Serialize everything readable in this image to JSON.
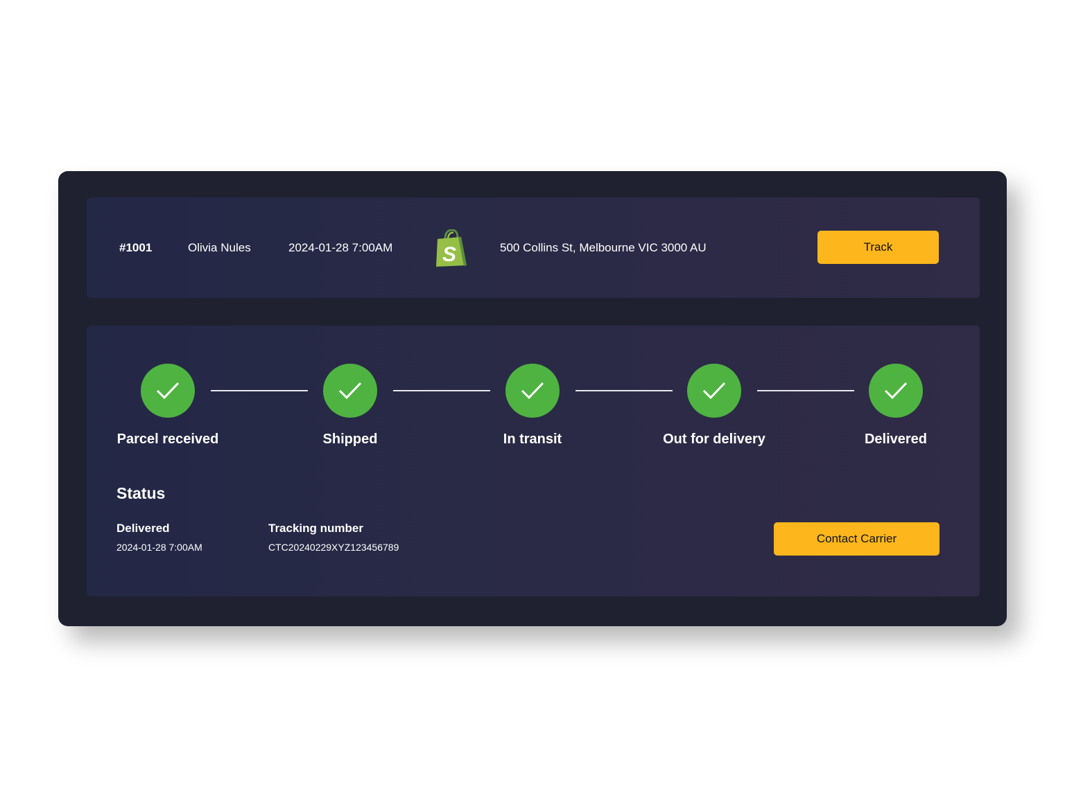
{
  "order": {
    "id": "#1001",
    "customer": "Olivia Nules",
    "date": "2024-01-28 7:00AM",
    "platform_icon": "shopify-bag-icon",
    "address": "500 Collins St, Melbourne VIC 3000 AU",
    "track_label": "Track"
  },
  "progress": {
    "steps": [
      {
        "label": "Parcel received",
        "completed": true,
        "icon": "check-icon"
      },
      {
        "label": "Shipped",
        "completed": true,
        "icon": "check-icon"
      },
      {
        "label": "In transit",
        "completed": true,
        "icon": "check-icon"
      },
      {
        "label": "Out for delivery",
        "completed": true,
        "icon": "check-icon"
      },
      {
        "label": "Delivered",
        "completed": true,
        "icon": "check-icon"
      }
    ],
    "completed_color": "#4fb342"
  },
  "status": {
    "title": "Status",
    "state_label": "Delivered",
    "state_time": "2024-01-28 7:00AM",
    "tracking_label": "Tracking number",
    "tracking_number": "CTC20240229XYZ123456789",
    "contact_label": "Contact Carrier"
  },
  "colors": {
    "accent": "#fdb71c",
    "success": "#4fb342",
    "card_bg": "#1f2130",
    "panel_bg_start": "#232846",
    "panel_bg_end": "#302b46"
  }
}
